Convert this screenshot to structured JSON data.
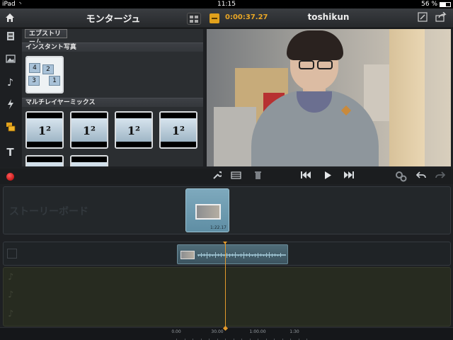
{
  "status_bar": {
    "carrier": "iPad",
    "time": "11:15",
    "battery": "56 %",
    "battery_level": 0.56
  },
  "toolbar": {
    "title": "モンタージュ",
    "timecode": "0:00:37.27",
    "project_user": "toshikun",
    "icons": [
      "home-icon",
      "grid-icon",
      "clip-icon",
      "edit-icon",
      "share-icon"
    ]
  },
  "left_icons": [
    "film-icon",
    "image-icon",
    "music-note-icon",
    "lightning-icon",
    "clips-icon",
    "text-icon"
  ],
  "browser": {
    "sections": [
      {
        "title": "エブストリーム"
      },
      {
        "title": "インスタント写真",
        "items": 1
      },
      {
        "title": "マルチレイヤーミックス",
        "items": 6
      }
    ],
    "thumbnail_text": "1²",
    "instant_digits": [
      "4",
      "2",
      "3",
      "1"
    ]
  },
  "transport": {
    "icons": [
      "record-icon",
      "wrench-icon",
      "frames-icon",
      "trash-icon",
      "skip-back-icon",
      "play-icon",
      "skip-forward-icon",
      "settings-gears-icon",
      "undo-icon",
      "redo-icon"
    ]
  },
  "storyboard": {
    "label": "ストーリーボード",
    "clip_duration": "1:22.17"
  },
  "timeline": {
    "ruler_labels": [
      "0.00",
      "30.00",
      "1:00.00",
      "1:30"
    ],
    "accent_color": "#e39a2b"
  }
}
